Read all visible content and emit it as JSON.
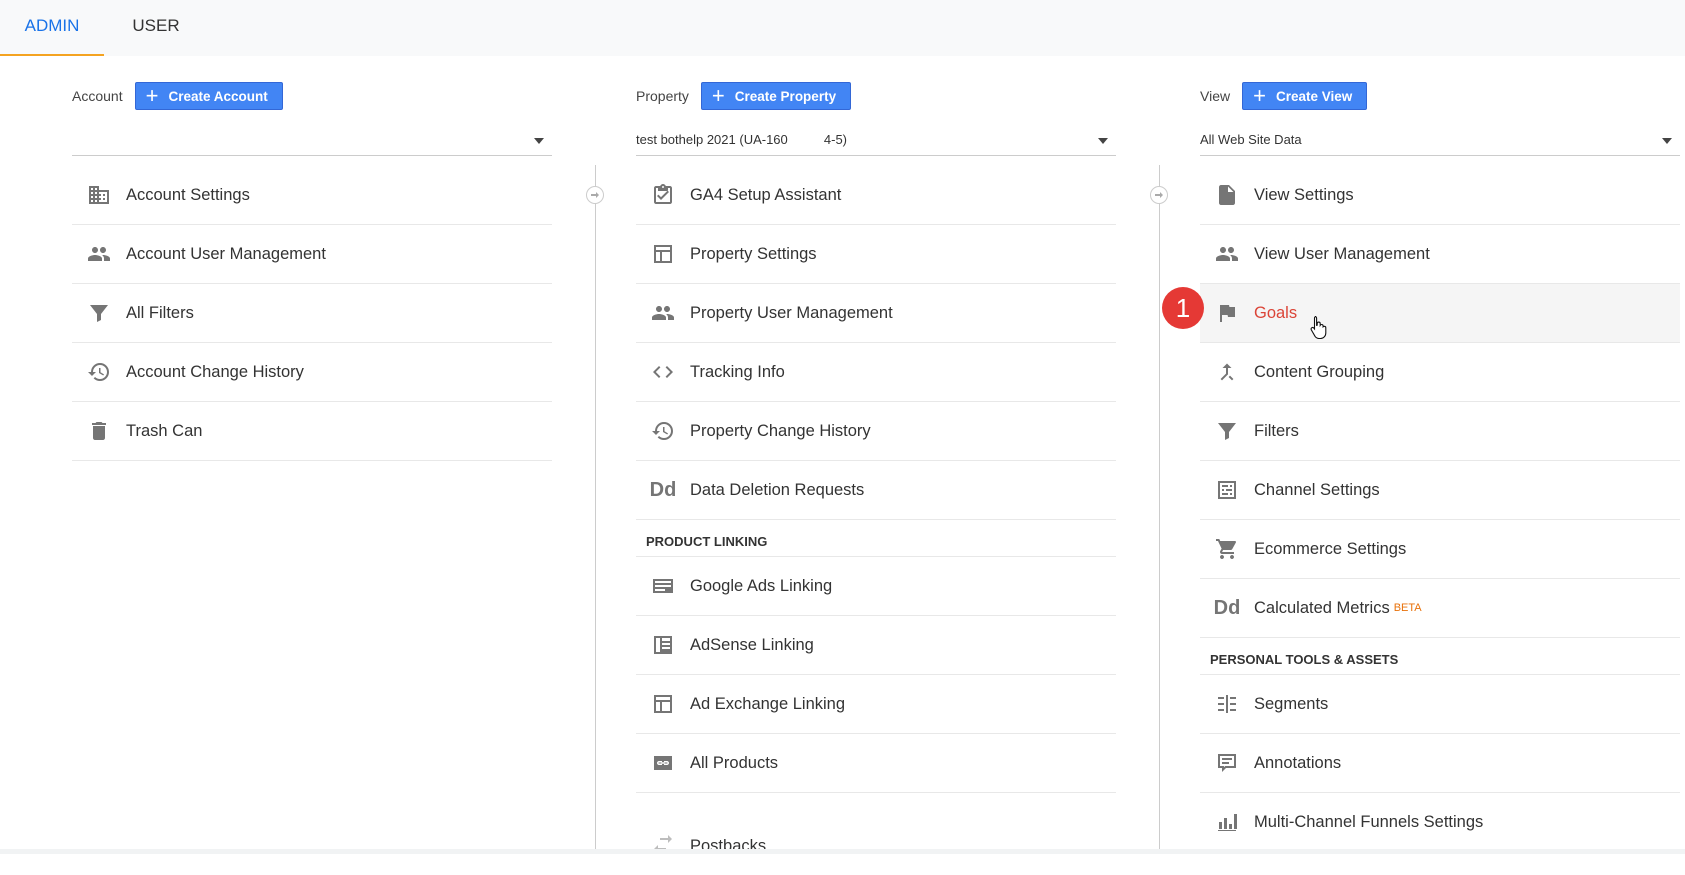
{
  "tabs": {
    "admin": "ADMIN",
    "user": "USER"
  },
  "account": {
    "label": "Account",
    "create_label": "Create Account",
    "selected": "",
    "items": [
      "Account Settings",
      "Account User Management",
      "All Filters",
      "Account Change History",
      "Trash Can"
    ]
  },
  "property": {
    "label": "Property",
    "create_label": "Create Property",
    "selected": "test bothelp 2021 (UA-160          4-5)",
    "items": [
      "GA4 Setup Assistant",
      "Property Settings",
      "Property User Management",
      "Tracking Info",
      "Property Change History",
      "Data Deletion Requests"
    ],
    "section_title": "PRODUCT LINKING",
    "linking_items": [
      "Google Ads Linking",
      "AdSense Linking",
      "Ad Exchange Linking",
      "All Products"
    ],
    "extra_item": "Postbacks"
  },
  "view": {
    "label": "View",
    "create_label": "Create View",
    "selected": "All Web Site Data",
    "items": [
      "View Settings",
      "View User Management",
      "Goals",
      "Content Grouping",
      "Filters",
      "Channel Settings",
      "Ecommerce Settings",
      "Calculated Metrics"
    ],
    "beta_label": "BETA",
    "section_title": "PERSONAL TOOLS & ASSETS",
    "tools_items": [
      "Segments",
      "Annotations",
      "Multi-Channel Funnels Settings"
    ]
  },
  "step_badge": "1",
  "icons": {
    "dd_text": "Dd"
  },
  "colors": {
    "accent": "#4285f4",
    "active_text": "#db4437",
    "tab_underline": "#f4a321",
    "badge": "#e53935"
  }
}
